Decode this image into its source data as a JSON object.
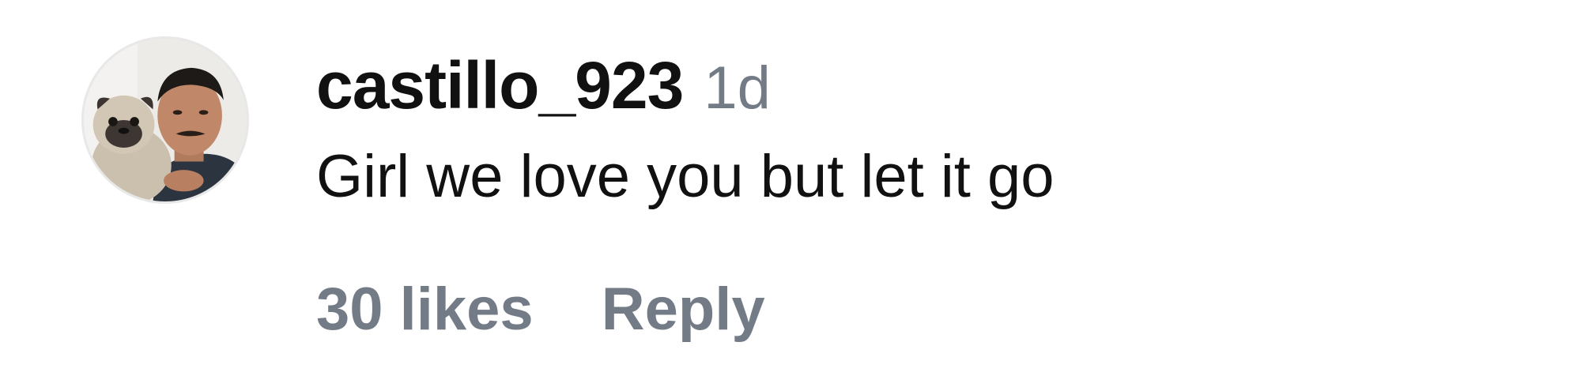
{
  "comment": {
    "author": {
      "username": "castillo_923",
      "avatar_icon": "profile-photo-person-with-pug"
    },
    "timestamp": "1d",
    "text": "Girl we love you but let it go",
    "likes_label": "30 likes",
    "reply_label": "Reply"
  },
  "colors": {
    "primary_text": "#111111",
    "secondary_text": "#737c86",
    "background": "#ffffff"
  }
}
